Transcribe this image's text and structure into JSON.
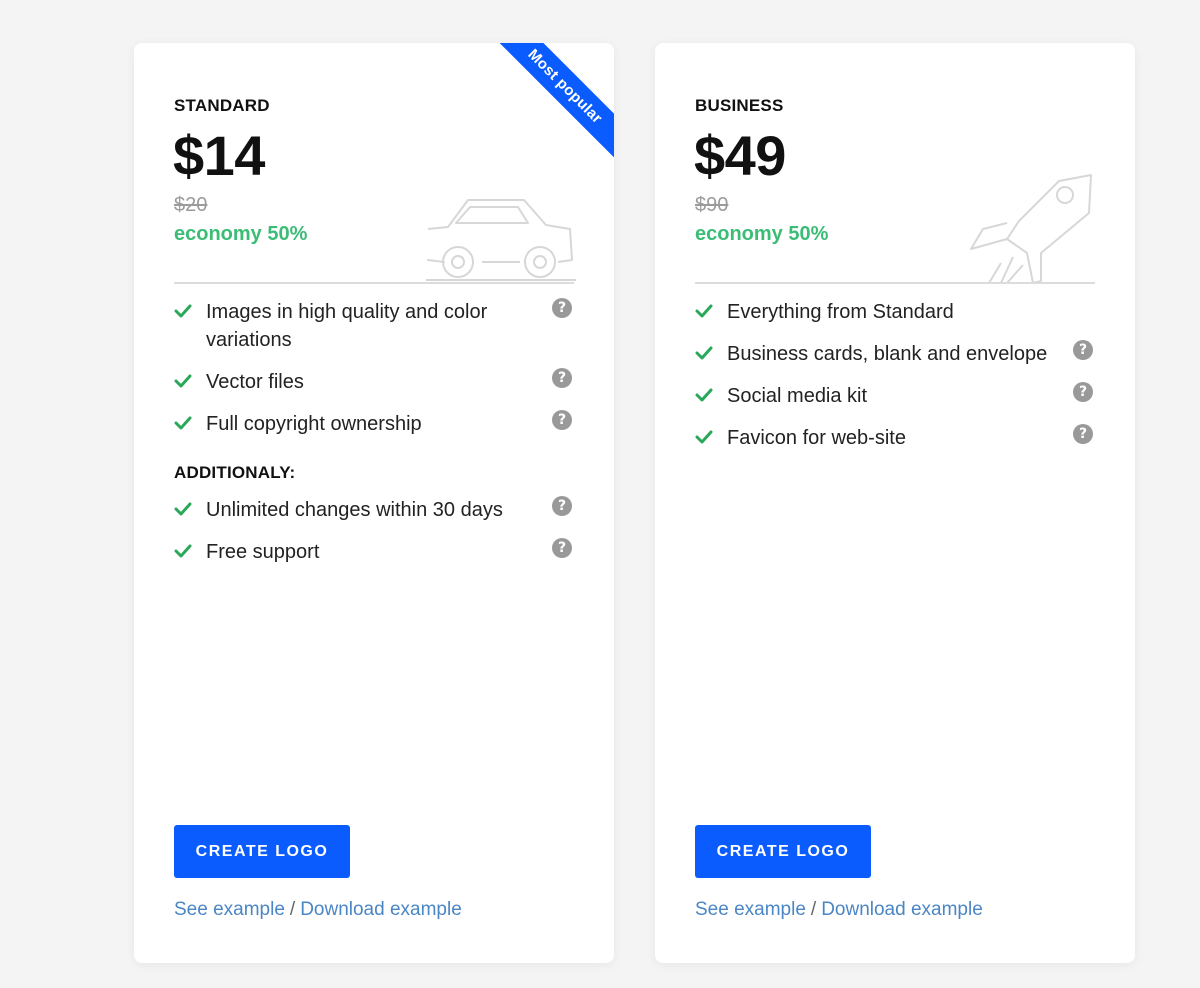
{
  "colors": {
    "accent": "#0a5cff",
    "economy": "#3bbd76",
    "check": "#2aa85a",
    "link": "#4a86c5",
    "help": "#999999"
  },
  "icons": {
    "check": "check-icon",
    "help": "help-circle-icon",
    "standard_illustration": "car-icon",
    "business_illustration": "rocket-icon"
  },
  "standard": {
    "ribbon": "Most popular",
    "name": "STANDARD",
    "price": "$14",
    "old_price": "$20",
    "economy": "economy 50%",
    "features": [
      {
        "label": "Images in high quality and color variations",
        "help": "?"
      },
      {
        "label": "Vector files",
        "help": "?"
      },
      {
        "label": "Full copyright ownership",
        "help": "?"
      }
    ],
    "additional_title": "ADDITIONALY:",
    "additional": [
      {
        "label": "Unlimited changes within 30 days",
        "help": "?"
      },
      {
        "label": "Free support",
        "help": "?"
      }
    ],
    "cta": "CREATE LOGO",
    "see_example": "See example",
    "separator": "/",
    "download_example": "Download example"
  },
  "business": {
    "name": "BUSINESS",
    "price": "$49",
    "old_price": "$90",
    "economy": "economy 50%",
    "features": [
      {
        "label": "Everything from Standard"
      },
      {
        "label": "Business cards, blank and envelope",
        "help": "?"
      },
      {
        "label": "Social media kit",
        "help": "?"
      },
      {
        "label": "Favicon for web-site",
        "help": "?"
      }
    ],
    "cta": "CREATE LOGO",
    "see_example": "See example",
    "separator": "/",
    "download_example": "Download example"
  }
}
